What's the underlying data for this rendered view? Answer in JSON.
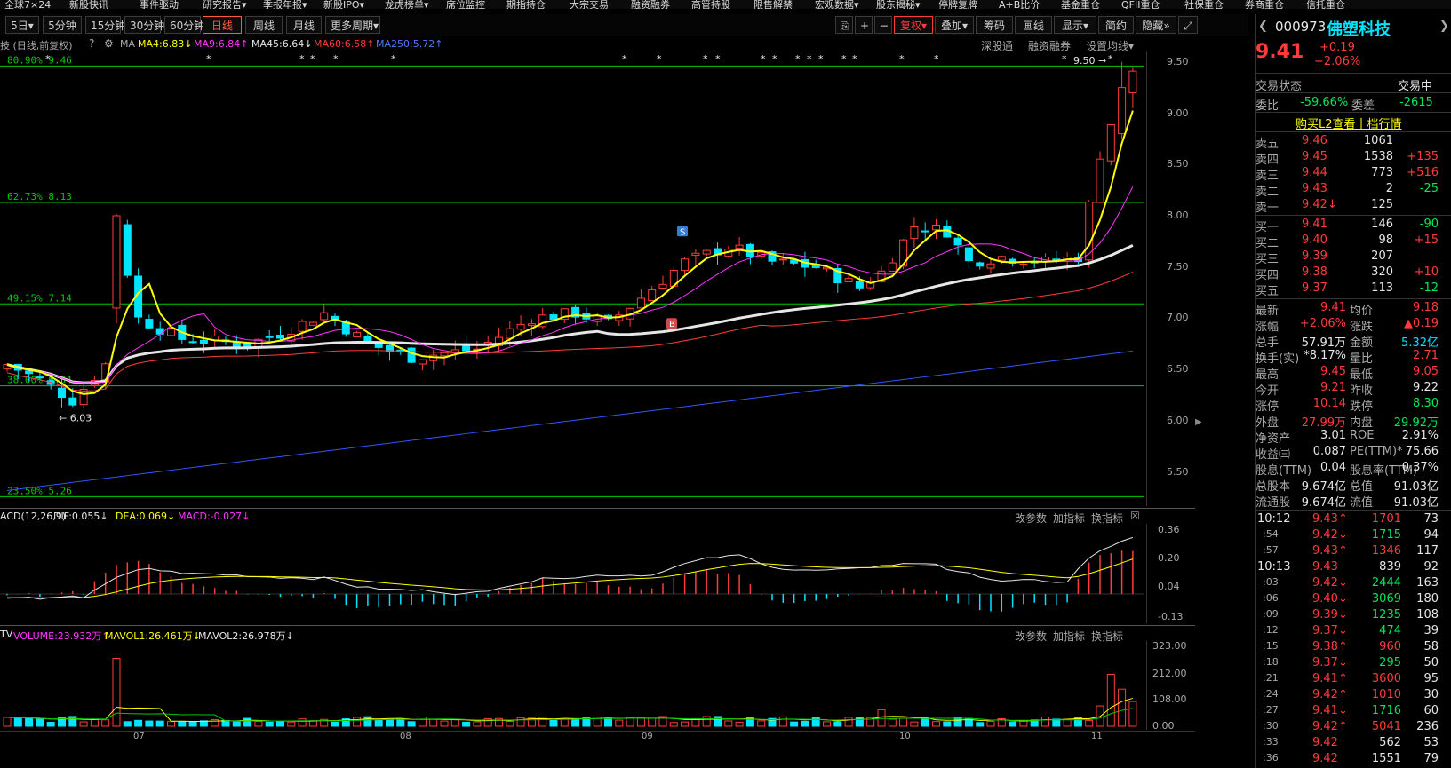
{
  "topnav": [
    "全球7×24",
    "新股快讯",
    "事件驱动",
    "研究报告▾",
    "季报年报▾",
    "新股IPO▾",
    "龙虎榜单▾",
    "席位监控",
    "期指持仓",
    "大宗交易",
    "融资融券",
    "高管持股",
    "限售解禁",
    "宏观数据▾",
    "股东揭秘▾",
    "停牌复牌",
    "A+B比价",
    "基金重仓",
    "QFII重仓",
    "社保重仓",
    "券商重仓",
    "信托重仓"
  ],
  "toolbar": {
    "periods": [
      "5日▾",
      "5分钟",
      "15分钟",
      "30分钟",
      "60分钟",
      "日线",
      "周线",
      "月线",
      "更多周期▾"
    ],
    "active": "日线",
    "right": [
      "复权▾",
      "叠加▾",
      "筹码",
      "画线",
      "显示▾",
      "简约",
      "隐藏»"
    ]
  },
  "ma_legend": {
    "prefix": "技 (日线,前复权)",
    "ma_label": "MA",
    "ma4": "MA4:6.83↓",
    "ma9": "MA9:6.84↑",
    "ma45": "MA45:6.64↓",
    "ma60": "MA60:6.58↑",
    "ma250": "MA250:5.72↑",
    "links": [
      "深股通",
      "融资融券",
      "设置均线▾"
    ]
  },
  "colors": {
    "ma4": "#ffff00",
    "ma9": "#ff33ff",
    "ma45": "#e6e6e6",
    "ma60": "#ff3b3b",
    "ma250": "#3355ff",
    "fib": "#00c800",
    "up": "#ff3b3b",
    "down": "#00e5ff"
  },
  "fib_levels": [
    {
      "label": "80.90%  9.46",
      "value": 9.46
    },
    {
      "label": "62.73%  8.13",
      "value": 8.13
    },
    {
      "label": "49.15%  7.14",
      "value": 7.14
    },
    {
      "label": "38.00%  6.34",
      "value": 6.34
    },
    {
      "label": "23.50%  5.26",
      "value": 5.26
    }
  ],
  "annotations": {
    "high": "9.50",
    "low": "6.03",
    "signal_s": "S",
    "signal_b": "B"
  },
  "price_axis": [
    "9.50",
    "9.00",
    "8.50",
    "8.00",
    "7.50",
    "7.00",
    "6.50",
    "6.00",
    "5.50"
  ],
  "macd_legend": {
    "name": "ACD(12,26,9)",
    "dif": "DIF:0.055↓",
    "dea": "DEA:0.069↓",
    "macd": "MACD:-0.027↓",
    "tools": [
      "改参数",
      "加指标",
      "换指标",
      "☒"
    ]
  },
  "macd_axis": [
    "0.36",
    "0.20",
    "0.04",
    "-0.13"
  ],
  "vol_legend": {
    "name": "TV",
    "volume": "VOLUME:23.932万↑",
    "mavol1": "MAVOL1:26.461万↓",
    "mavol2": "MAVOL2:26.978万↓",
    "tools": [
      "改参数",
      "加指标",
      "换指标"
    ]
  },
  "vol_axis": [
    "323.00",
    "212.00",
    "108.00",
    "0.00"
  ],
  "months": [
    "07",
    "08",
    "09",
    "10",
    "11"
  ],
  "stock": {
    "code": "000973",
    "name": "佛塑科技",
    "price": "9.41",
    "change": "+0.19",
    "pct": "+2.06%"
  },
  "status": {
    "label": "交易状态",
    "value": "交易中"
  },
  "weibi": {
    "label": "委比",
    "value": "-59.66%",
    "label2": "委差",
    "value2": "-2615"
  },
  "buy_l2": "购买L2查看十档行情",
  "asks": [
    {
      "label": "卖五",
      "price": "9.46",
      "vol": "1061",
      "chg": ""
    },
    {
      "label": "卖四",
      "price": "9.45",
      "vol": "1538",
      "chg": "+135"
    },
    {
      "label": "卖三",
      "price": "9.44",
      "vol": "773",
      "chg": "+516"
    },
    {
      "label": "卖二",
      "price": "9.43",
      "vol": "2",
      "chg": "-25"
    },
    {
      "label": "卖一",
      "price": "9.42↓",
      "vol": "125",
      "chg": ""
    }
  ],
  "bids": [
    {
      "label": "买一",
      "price": "9.41",
      "vol": "146",
      "chg": "-90"
    },
    {
      "label": "买二",
      "price": "9.40",
      "vol": "98",
      "chg": "+15"
    },
    {
      "label": "买三",
      "price": "9.39",
      "vol": "207",
      "chg": ""
    },
    {
      "label": "买四",
      "price": "9.38",
      "vol": "320",
      "chg": "+10"
    },
    {
      "label": "买五",
      "price": "9.37",
      "vol": "113",
      "chg": "-12"
    }
  ],
  "stats": [
    [
      "最新",
      "9.41",
      "均价",
      "9.18"
    ],
    [
      "涨幅",
      "+2.06%",
      "涨跌",
      "▲0.19"
    ],
    [
      "总手",
      "57.91万",
      "金额",
      "5.32亿"
    ],
    [
      "换手(实)",
      "*8.17%",
      "量比",
      "2.71"
    ],
    [
      "最高",
      "9.45",
      "最低",
      "9.05"
    ],
    [
      "今开",
      "9.21",
      "昨收",
      "9.22"
    ],
    [
      "涨停",
      "10.14",
      "跌停",
      "8.30"
    ],
    [
      "外盘",
      "27.99万",
      "内盘",
      "29.92万"
    ],
    [
      "净资产",
      "3.01",
      "ROE",
      "2.91%"
    ],
    [
      "收益㈢",
      "0.087",
      "PE(TTM)*",
      "75.66"
    ],
    [
      "股息(TTM)",
      "0.04",
      "股息率(TTM)",
      "0.37%"
    ],
    [
      "总股本",
      "9.674亿",
      "总值",
      "91.03亿"
    ],
    [
      "流通股",
      "9.674亿",
      "流值",
      "91.03亿"
    ]
  ],
  "ticks": [
    {
      "time": "10:12",
      "price": "9.43↑",
      "vol": "1701",
      "n": "73"
    },
    {
      "time": ":54",
      "price": "9.42↓",
      "vol": "1715",
      "n": "94"
    },
    {
      "time": ":57",
      "price": "9.43↑",
      "vol": "1346",
      "n": "117"
    },
    {
      "time": "10:13",
      "price": "9.43",
      "vol": "839",
      "n": "92"
    },
    {
      "time": ":03",
      "price": "9.42↓",
      "vol": "2444",
      "n": "163"
    },
    {
      "time": ":06",
      "price": "9.40↓",
      "vol": "3069",
      "n": "180"
    },
    {
      "time": ":09",
      "price": "9.39↓",
      "vol": "1235",
      "n": "108"
    },
    {
      "time": ":12",
      "price": "9.37↓",
      "vol": "474",
      "n": "39"
    },
    {
      "time": ":15",
      "price": "9.38↑",
      "vol": "960",
      "n": "58"
    },
    {
      "time": ":18",
      "price": "9.37↓",
      "vol": "295",
      "n": "50"
    },
    {
      "time": ":21",
      "price": "9.41↑",
      "vol": "3600",
      "n": "95"
    },
    {
      "time": ":24",
      "price": "9.42↑",
      "vol": "1010",
      "n": "30"
    },
    {
      "time": ":27",
      "price": "9.41↓",
      "vol": "1716",
      "n": "60"
    },
    {
      "time": ":30",
      "price": "9.42↑",
      "vol": "5041",
      "n": "236"
    },
    {
      "time": ":33",
      "price": "9.42",
      "vol": "562",
      "n": "53"
    },
    {
      "time": ":36",
      "price": "9.42",
      "vol": "1551",
      "n": "79"
    }
  ]
}
